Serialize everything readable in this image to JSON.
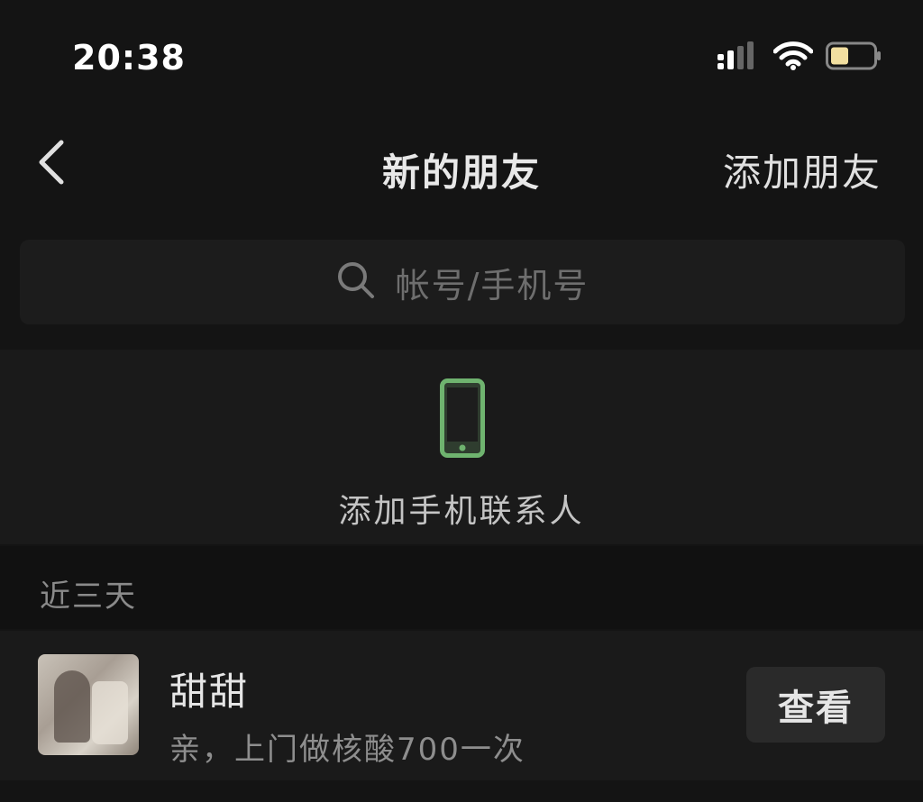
{
  "status_bar": {
    "time": "20:38",
    "icons": [
      "cellular-signal-icon",
      "wifi-icon",
      "battery-icon"
    ]
  },
  "nav": {
    "back_icon": "chevron-left-icon",
    "title": "新的朋友",
    "action_label": "添加朋友"
  },
  "search": {
    "icon": "search-icon",
    "placeholder": "帐号/手机号"
  },
  "add_contacts": {
    "icon": "phone-icon",
    "label": "添加手机联系人"
  },
  "section": {
    "title": "近三天"
  },
  "friend_requests": [
    {
      "name": "甜甜",
      "message": "亲，上门做核酸700一次",
      "button_label": "查看"
    }
  ],
  "colors": {
    "background": "#141414",
    "phone_icon_accent": "#6fb36f",
    "battery_fill": "#f2dfa0"
  }
}
